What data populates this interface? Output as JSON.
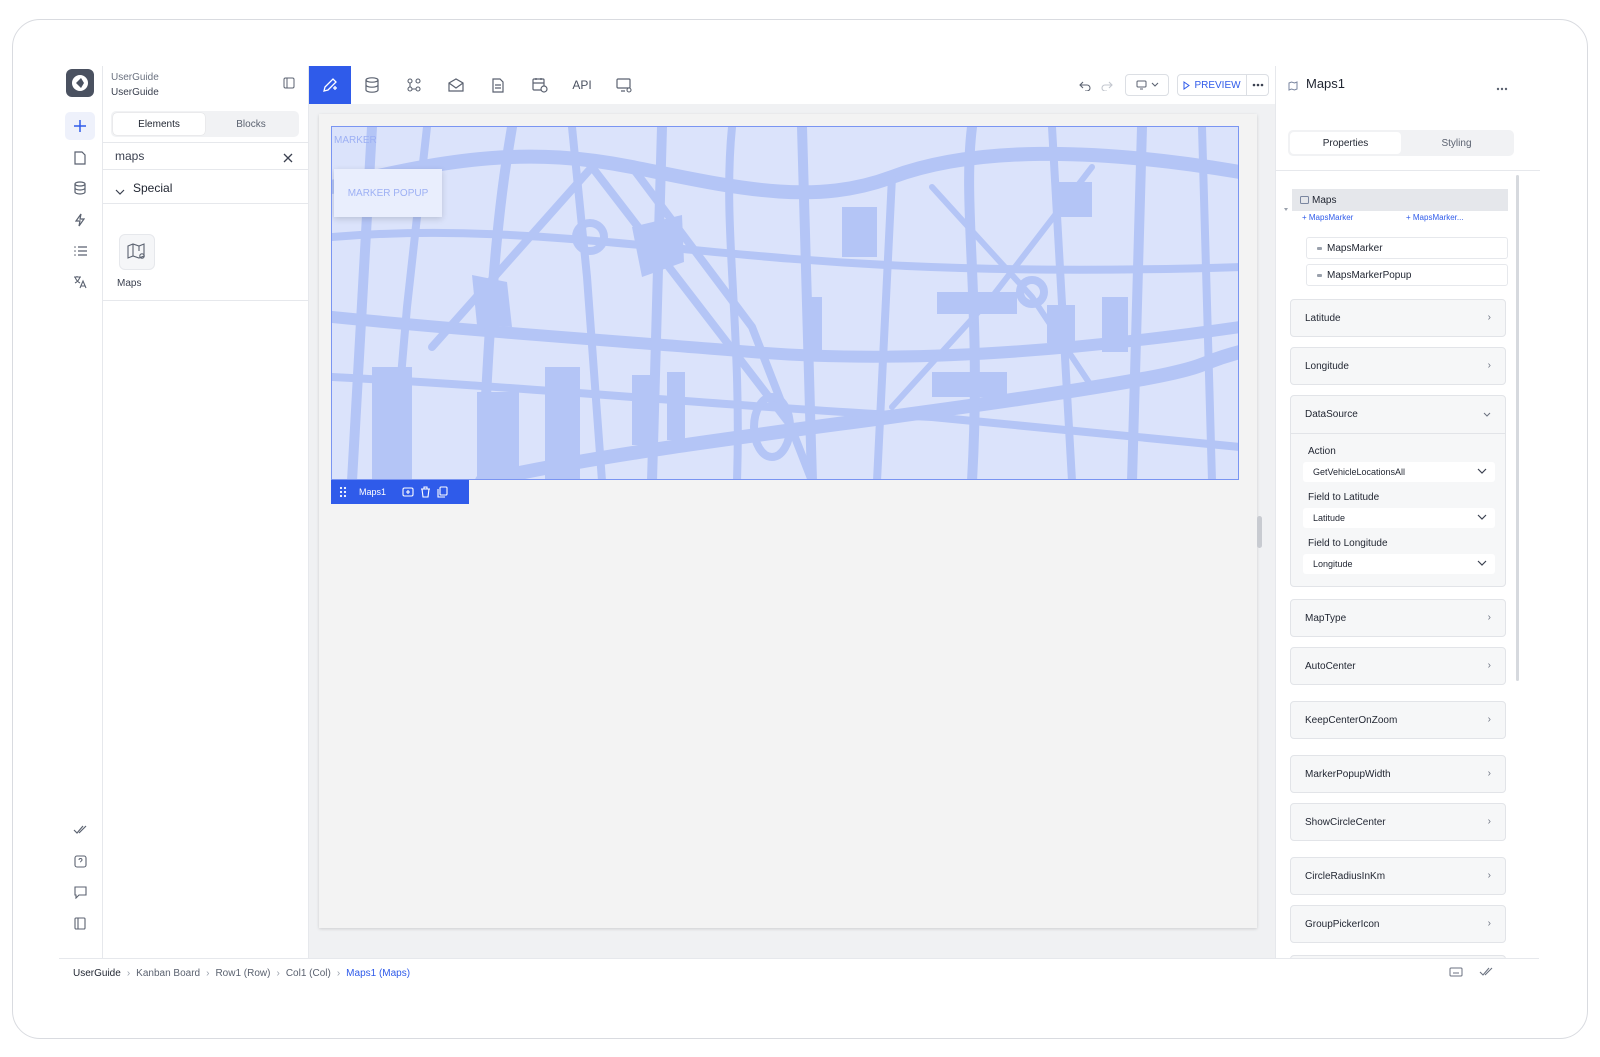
{
  "project": {
    "name": "UserGuide",
    "subtitle": "UserGuide"
  },
  "left_panel": {
    "tabs": [
      {
        "label": "Elements",
        "active": true
      },
      {
        "label": "Blocks",
        "active": false
      }
    ],
    "search_value": "maps",
    "section": "Special",
    "element_tile": {
      "label": "Maps",
      "icon": "map-icon"
    }
  },
  "toolbar": {
    "api_label": "API",
    "preview_label": "PREVIEW"
  },
  "canvas": {
    "marker_label": "MARKER",
    "marker_popup_label": "MARKER POPUP",
    "selected_component": "Maps1"
  },
  "right_panel": {
    "title": "Maps1",
    "tabs": [
      {
        "label": "Properties",
        "active": true
      },
      {
        "label": "Styling",
        "active": false
      }
    ],
    "tree": {
      "root": "Maps",
      "add_links": [
        "+ MapsMarker",
        "+ MapsMarker..."
      ],
      "children": [
        "MapsMarker",
        "MapsMarkerPopup"
      ]
    },
    "props_top": [
      "Latitude",
      "Longitude"
    ],
    "datasource": {
      "title": "DataSource",
      "fields": [
        {
          "label": "Action",
          "value": "GetVehicleLocationsAll"
        },
        {
          "label": "Field to Latitude",
          "value": "Latitude"
        },
        {
          "label": "Field to Longitude",
          "value": "Longitude"
        }
      ]
    },
    "props_bottom": [
      "MapType",
      "AutoCenter",
      "KeepCenterOnZoom",
      "MarkerPopupWidth",
      "ShowCircleCenter",
      "CircleRadiusInKm",
      "GroupPickerIcon"
    ]
  },
  "breadcrumb": [
    "UserGuide",
    "Kanban Board",
    "Row1 (Row)",
    "Col1 (Col)",
    "Maps1 (Maps)"
  ],
  "colors": {
    "accent": "#2f5bea",
    "map_bg": "#dbe3fb",
    "map_road": "#b2c4f6"
  }
}
